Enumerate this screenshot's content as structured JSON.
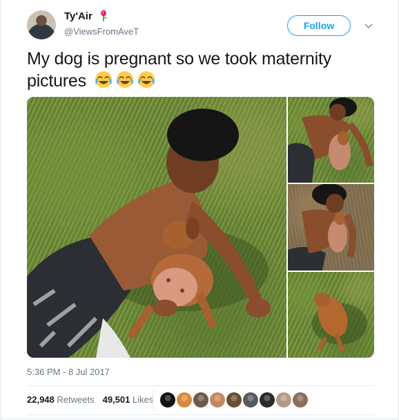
{
  "author": {
    "name": "Ty'Air",
    "handle": "@ViewsFromAveT",
    "badge_icon": "rose-icon"
  },
  "header": {
    "follow_label": "Follow",
    "menu_icon": "chevron-down-icon"
  },
  "tweet": {
    "text": "My dog is pregnant so we took maternity pictures",
    "emoji": [
      "joy-emoji-icon",
      "joy-emoji-icon",
      "joy-emoji-icon"
    ],
    "media_count": 4
  },
  "meta": {
    "timestamp": "5:36 PM - 8 Jul 2017"
  },
  "stats": {
    "retweets_count": "22,948",
    "retweets_label": "Retweets",
    "likes_count": "49,501",
    "likes_label": "Likes",
    "liker_avatar_colors": [
      "#111111",
      "#d9893f",
      "#6d5a4b",
      "#c7865f",
      "#6a4e32",
      "#555b61",
      "#2a2a2a",
      "#b59a86",
      "#8a6d5a"
    ]
  },
  "colors": {
    "accent": "#1da1f2",
    "text": "#14171a",
    "secondary": "#657786"
  }
}
